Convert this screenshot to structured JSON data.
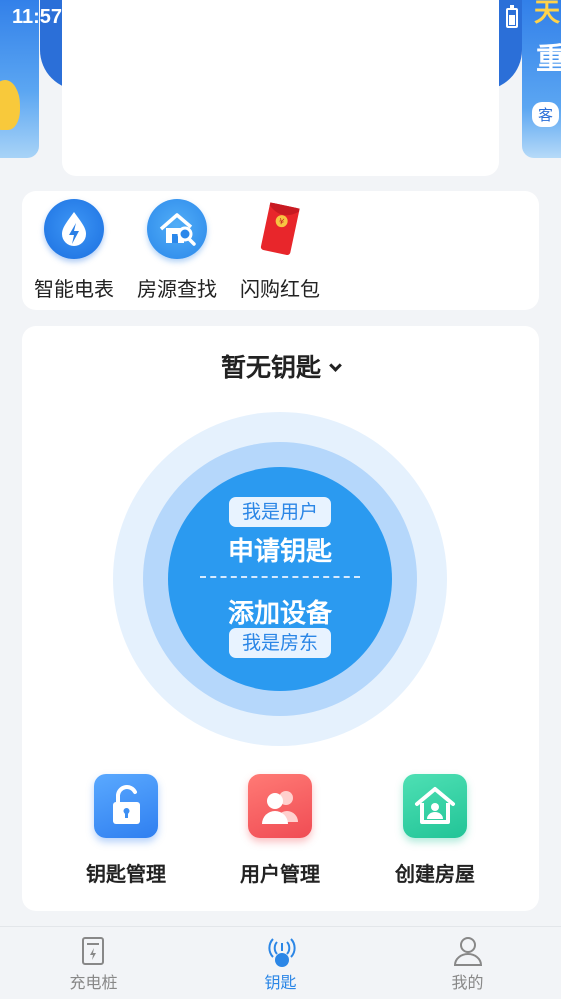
{
  "status": {
    "time": "11:57"
  },
  "banner": {
    "right_line1": "天",
    "right_line2": "重",
    "right_pill": "客"
  },
  "quick_menu": [
    {
      "label": "智能电表",
      "icon": "lightning-drop-icon"
    },
    {
      "label": "房源查找",
      "icon": "house-search-icon"
    },
    {
      "label": "闪购红包",
      "icon": "red-envelope-icon"
    }
  ],
  "key_panel": {
    "title": "暂无钥匙",
    "user_tag": "我是用户",
    "apply_label": "申请钥匙",
    "add_label": "添加设备",
    "owner_tag": "我是房东",
    "actions": [
      {
        "label": "钥匙管理",
        "icon": "unlock-icon"
      },
      {
        "label": "用户管理",
        "icon": "users-icon"
      },
      {
        "label": "创建房屋",
        "icon": "home-user-icon"
      }
    ]
  },
  "bottom_nav": [
    {
      "label": "充电桩",
      "icon": "charging-pile-icon",
      "active": false
    },
    {
      "label": "钥匙",
      "icon": "key-signal-icon",
      "active": true
    },
    {
      "label": "我的",
      "icon": "profile-icon",
      "active": false
    }
  ],
  "colors": {
    "accent": "#2b9af0",
    "active_nav": "#2b86e6",
    "background": "#f2f4f7"
  }
}
